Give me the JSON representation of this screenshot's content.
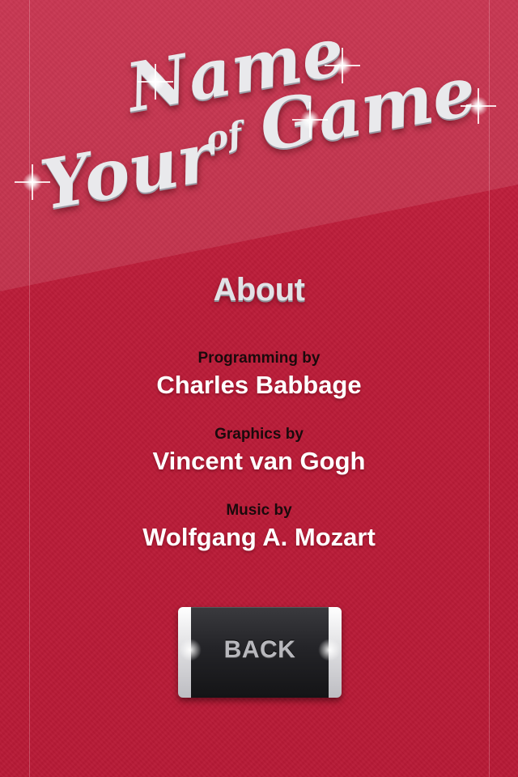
{
  "logo": {
    "word_name": "Name",
    "word_of": "of",
    "word_your": "Your",
    "word_game": "Game"
  },
  "about": {
    "title": "About",
    "credits": [
      {
        "role": "Programming by",
        "name": "Charles Babbage"
      },
      {
        "role": "Graphics by",
        "name": "Vincent van Gogh"
      },
      {
        "role": "Music by",
        "name": "Wolfgang A. Mozart"
      }
    ]
  },
  "back_button": {
    "label": "BACK"
  },
  "colors": {
    "background": "#bb1c38",
    "credit_role_text": "#1a0a0c",
    "credit_name_text": "#ffffff",
    "button_body": "#242428"
  },
  "icons": {
    "logo_sparkle": "sparkle-icon",
    "button_highlight": "glow-icon"
  }
}
